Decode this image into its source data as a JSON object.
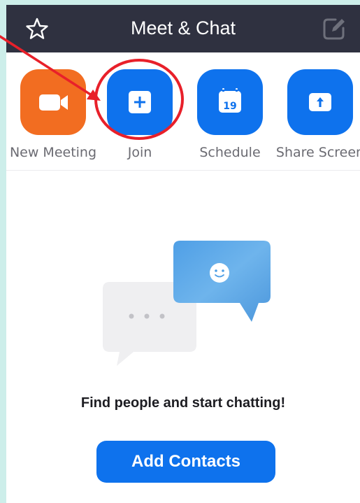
{
  "header": {
    "title": "Meet & Chat",
    "left_icon": "star-icon",
    "right_icon": "compose-icon"
  },
  "actions": [
    {
      "id": "new-meeting",
      "label": "New Meeting",
      "icon": "video-camera-icon",
      "color": "#f26d21"
    },
    {
      "id": "join",
      "label": "Join",
      "icon": "plus-icon",
      "color": "#0e72ed"
    },
    {
      "id": "schedule",
      "label": "Schedule",
      "icon": "calendar-icon",
      "calendar_day": "19",
      "color": "#0e72ed"
    },
    {
      "id": "share-screen",
      "label": "Share Screen",
      "icon": "upload-arrow-icon",
      "color": "#0e72ed"
    }
  ],
  "empty_state": {
    "message": "Find people and start chatting!",
    "button_label": "Add Contacts"
  },
  "annotation": {
    "highlight_color": "#e8202a",
    "target": "join"
  },
  "colors": {
    "header_bg": "#2f3140",
    "accent_blue": "#0e72ed",
    "accent_orange": "#f26d21",
    "page_border": "#cdeeea"
  }
}
